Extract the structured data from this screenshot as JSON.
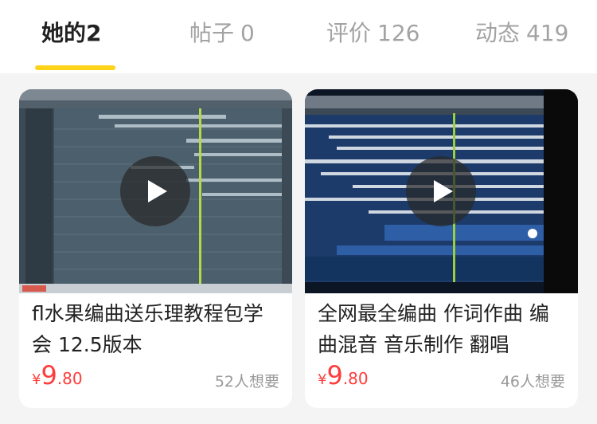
{
  "tabs": [
    {
      "label": "她的",
      "count": "2",
      "active": true
    },
    {
      "label": "帖子",
      "count": "0",
      "active": false
    },
    {
      "label": "评价",
      "count": "126",
      "active": false
    },
    {
      "label": "动态",
      "count": "419",
      "active": false
    }
  ],
  "colors": {
    "accent": "#ffd31a",
    "price": "#ff3b3b",
    "background": "#f4f4f4"
  },
  "items": [
    {
      "title": "fl水果编曲送乐理教程包学会 12.5版本",
      "price": {
        "currency": "¥",
        "integer": "9",
        "decimal": ".80"
      },
      "wants": "52人想要",
      "thumbnail_icon": "play-icon"
    },
    {
      "title": "全网最全编曲 作词作曲 编曲混音 音乐制作 翻唱",
      "price": {
        "currency": "¥",
        "integer": "9",
        "decimal": ".80"
      },
      "wants": "46人想要",
      "thumbnail_icon": "play-icon"
    }
  ]
}
